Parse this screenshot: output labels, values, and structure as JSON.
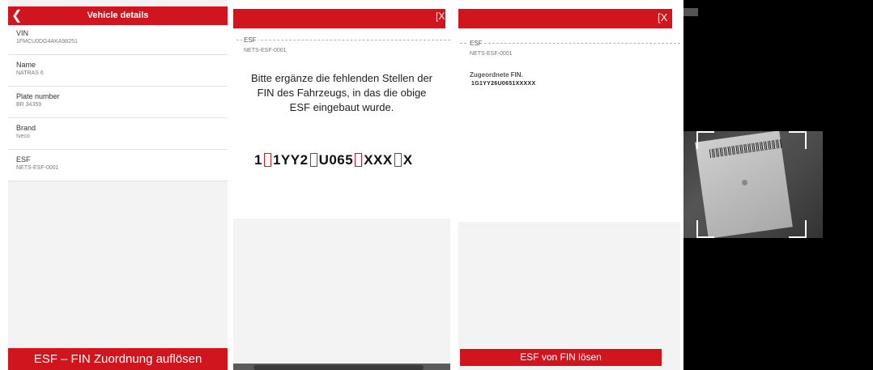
{
  "screen1": {
    "header_title": "Vehicle details",
    "back_icon": "chevron-left-icon",
    "fields": [
      {
        "label": "VIN",
        "value": "1FMCU0DG4AKA98251"
      },
      {
        "label": "Name",
        "value": "NATRAS 6"
      },
      {
        "label": "Plate number",
        "value": "BR 34359"
      },
      {
        "label": "Brand",
        "value": "Iveco"
      },
      {
        "label": "ESF",
        "value": "NETS-ESF-0001"
      }
    ],
    "footer_button": "ESF – FIN Zuordnung auflösen"
  },
  "screen2": {
    "close_label": "[X",
    "esf_label": "ESF",
    "esf_value": "NETS-ESF-0001",
    "instruction": "Bitte ergänze die fehlenden Stellen der FIN des Fahrzeugs, in das die obige ESF eingebaut wurde.",
    "vin_parts": [
      "1",
      "1YY2",
      "U065",
      "XXX",
      "X"
    ]
  },
  "screen3": {
    "close_label": "[X",
    "esf_label": "ESF",
    "esf_value": "NETS-ESF-0001",
    "assigned_label": "Zugeordnete FIN.",
    "assigned_value": "1G1YY26U0651XXXXX",
    "footer_button": "ESF von FIN lösen"
  },
  "colors": {
    "accent": "#d0151f",
    "background": "#f3f3f3"
  }
}
